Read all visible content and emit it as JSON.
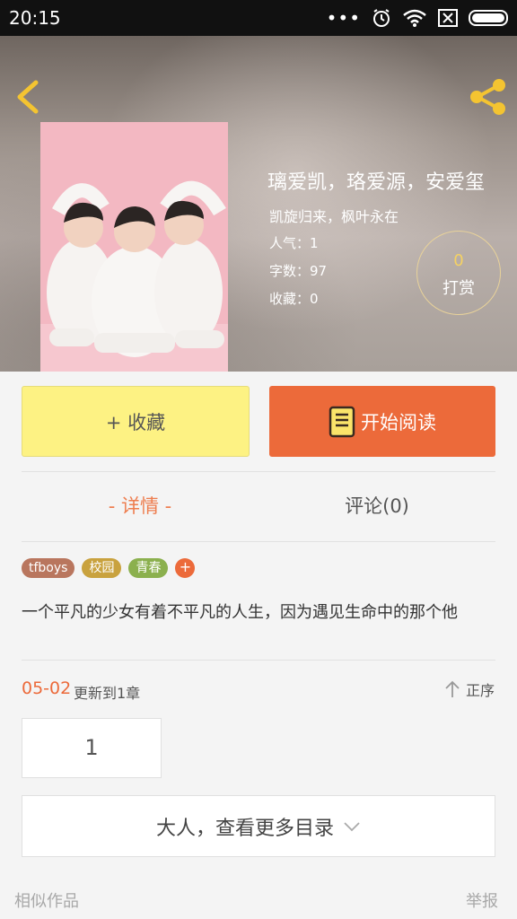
{
  "status_bar": {
    "time": "20:15",
    "dots": "•••"
  },
  "header": {
    "title": "璃爱凯，珞爱源，安爱玺",
    "subtitle": "凯旋归来，枫叶永在",
    "stats": [
      "人气：1",
      "字数：97",
      "收藏：0"
    ],
    "reward": {
      "count": "0",
      "label": "打赏"
    }
  },
  "actions": {
    "collect_label": "+ 收藏",
    "read_label": "开始阅读"
  },
  "tabs": {
    "detail": "- 详情 -",
    "comment": "评论(0)"
  },
  "tags": [
    {
      "label": "tfboys",
      "color": "#b9765e"
    },
    {
      "label": "校园",
      "color": "#c9a23e"
    },
    {
      "label": "青春",
      "color": "#8bb04e"
    }
  ],
  "tag_add": "+",
  "description": "一个平凡的少女有着不平凡的人生，因为遇见生命中的那个他",
  "update": {
    "date": "05-02",
    "text": "更新到1章",
    "sort_label": "正序"
  },
  "chapter_number": "1",
  "more_catalog": "大人，查看更多目录",
  "footer": {
    "similar": "相似作品",
    "report": "举报"
  },
  "colors": {
    "accent": "#ec6a3a",
    "reward_ring": "#e8d29a",
    "collect_bg": "#fdf283"
  }
}
